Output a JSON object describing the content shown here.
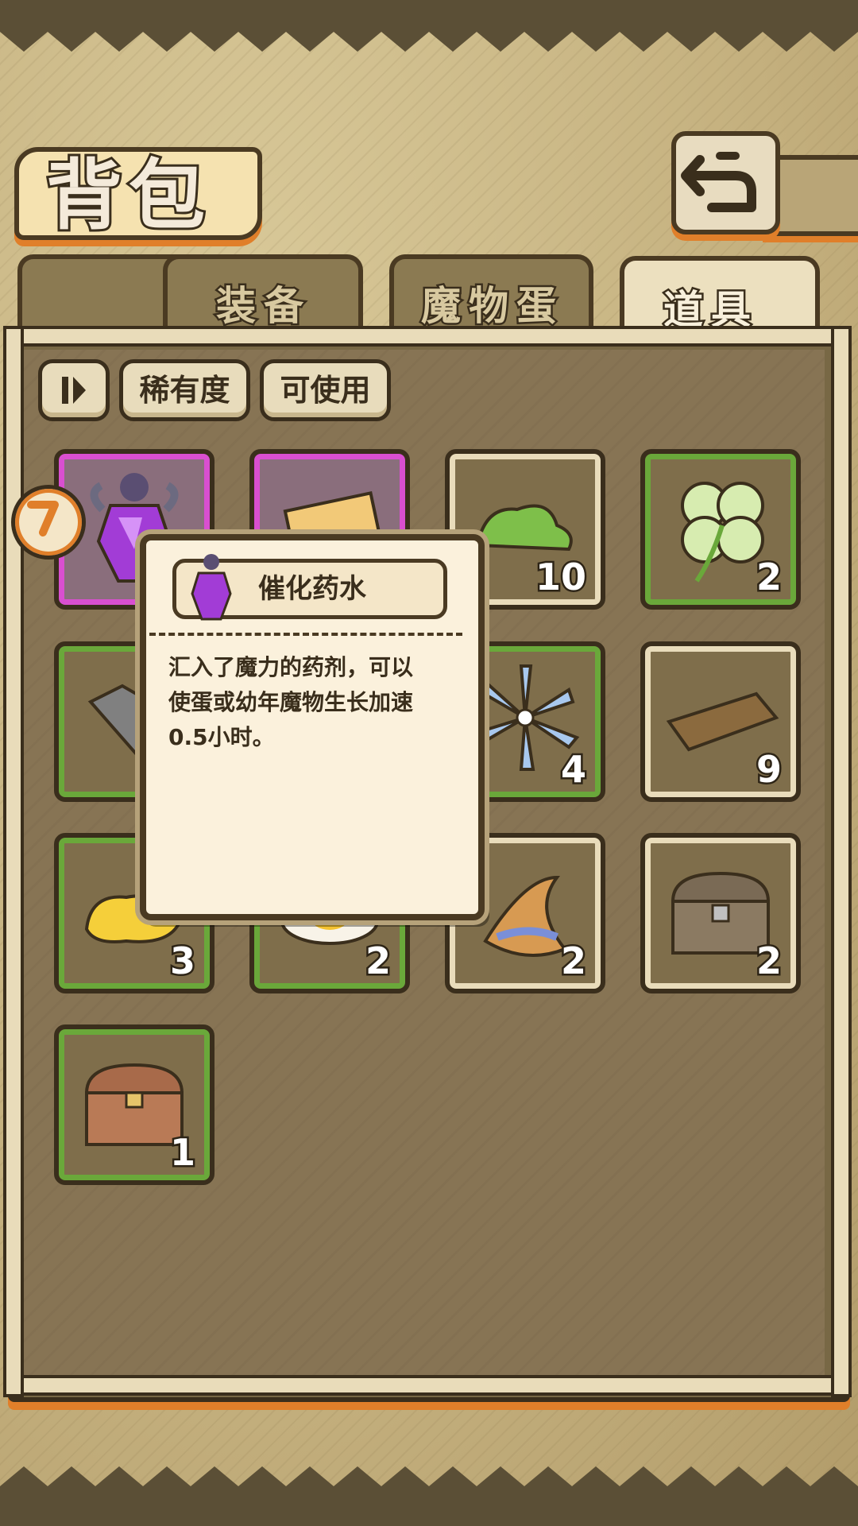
{
  "title": "背包",
  "back_button": {
    "icon": "return-icon"
  },
  "tabs": [
    {
      "label": "装备",
      "active": false
    },
    {
      "label": "魔物蛋",
      "active": false
    },
    {
      "label": "道具",
      "active": true
    }
  ],
  "filters": {
    "sort_icon": "sort-icon",
    "rarity_label": "稀有度",
    "usable_label": "可使用"
  },
  "items": [
    {
      "name": "catalyst-potion",
      "rarity": "purple",
      "count": ""
    },
    {
      "name": "scroll",
      "rarity": "purple",
      "count": ""
    },
    {
      "name": "green-slime",
      "rarity": "plain",
      "count": "10"
    },
    {
      "name": "four-leaf-clover",
      "rarity": "green",
      "count": "2"
    },
    {
      "name": "metal-ingot",
      "rarity": "green",
      "count": ""
    },
    {
      "name": "blank",
      "rarity": "green",
      "count": ""
    },
    {
      "name": "blue-flower",
      "rarity": "green",
      "count": "4"
    },
    {
      "name": "wood-plank",
      "rarity": "plain",
      "count": "9"
    },
    {
      "name": "gold-nugget",
      "rarity": "green",
      "count": "3"
    },
    {
      "name": "fried-egg",
      "rarity": "green",
      "count": "2"
    },
    {
      "name": "wizard-hat",
      "rarity": "plain",
      "count": "2"
    },
    {
      "name": "iron-chest",
      "rarity": "plain",
      "count": "2"
    },
    {
      "name": "wooden-chest",
      "rarity": "green",
      "count": "1"
    }
  ],
  "tooltip": {
    "item_name": "催化药水",
    "description_lines": [
      "汇入了魔力的药剂，可以",
      "使蛋或幼年魔物生长加速",
      "0.5小时。"
    ]
  },
  "colors": {
    "accent_orange": "#e07f2a",
    "outline": "#3a2e1c",
    "rarity_green": "#6aa83a",
    "rarity_purple": "#d94fd0",
    "panel": "#877454"
  }
}
